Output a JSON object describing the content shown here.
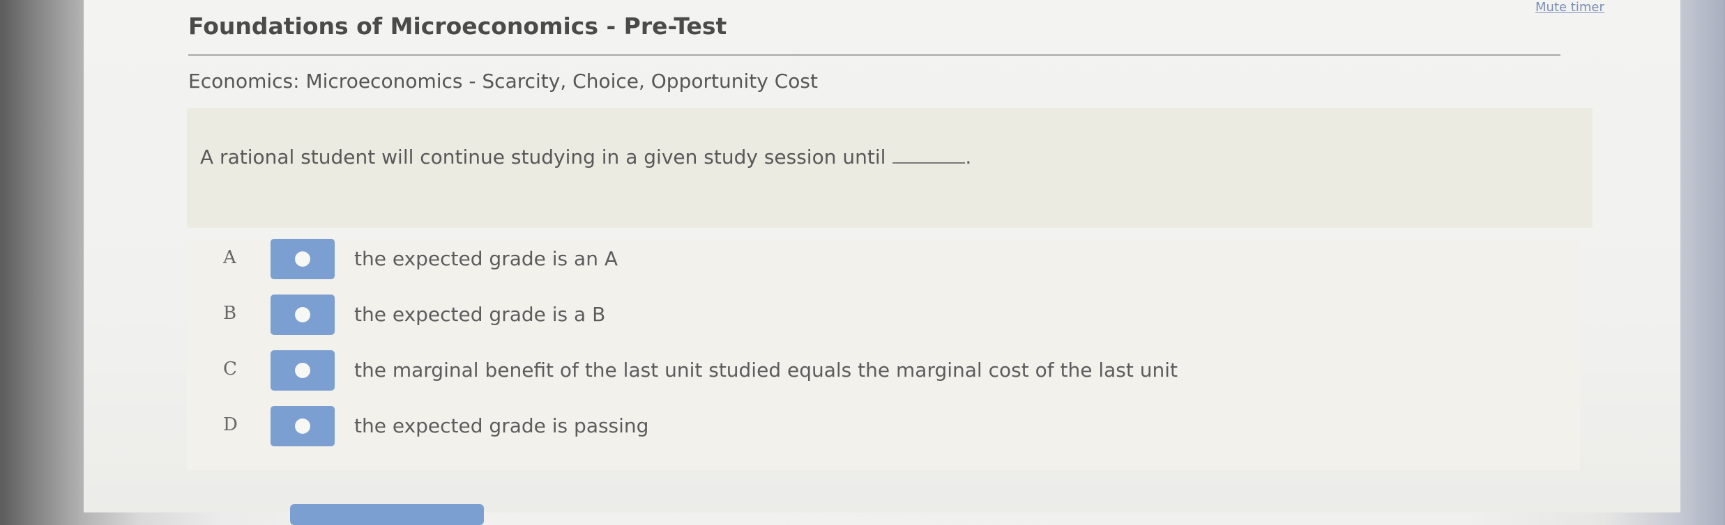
{
  "header": {
    "mute_timer": "Mute timer",
    "title": "Foundations of Microeconomics - Pre-Test",
    "subtitle": "Economics: Microeconomics - Scarcity, Choice, Opportunity Cost"
  },
  "question": {
    "text": "A rational student will continue studying in a given study session until",
    "blank_suffix": "."
  },
  "choices": [
    {
      "letter": "A",
      "text": "the expected grade is an A"
    },
    {
      "letter": "B",
      "text": "the expected grade is a B"
    },
    {
      "letter": "C",
      "text": "the marginal benefit of the last unit studied equals the marginal cost of the last unit"
    },
    {
      "letter": "D",
      "text": "the expected grade is passing"
    }
  ],
  "colors": {
    "button_blue": "#7a9fd0",
    "link_blue": "#7c8db6",
    "question_bg": "#ecebe2"
  }
}
